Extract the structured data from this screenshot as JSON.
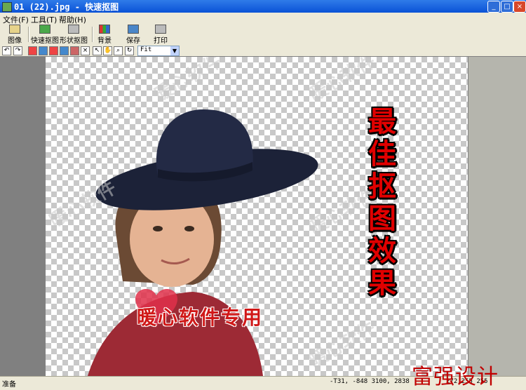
{
  "window": {
    "title": "01 (22).jpg - 快速抠图"
  },
  "menu": [
    {
      "label": "文件(F)"
    },
    {
      "label": "工具(T)"
    },
    {
      "label": "帮助(H)"
    }
  ],
  "toolbar": {
    "image": "图像",
    "quick_cut": "快速抠图",
    "shape_cut": "形状抠图",
    "background": "背景",
    "save": "保存",
    "print": "打印"
  },
  "zoom": {
    "value": "Fit"
  },
  "canvas": {
    "watermark": "暖心软件",
    "vertical_caption": "最佳抠图效果",
    "logo_caption": "暖心软件专用"
  },
  "status": {
    "text": "准备",
    "coords": "-T31, -848   3100, 2838",
    "rgb": "272 255 255"
  },
  "brand": "富强设计"
}
